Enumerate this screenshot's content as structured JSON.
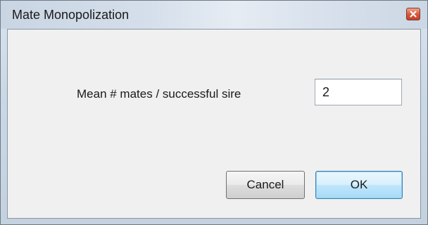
{
  "window": {
    "title": "Mate Monopolization"
  },
  "form": {
    "field_label": "Mean # mates / successful sire",
    "field_value": "2"
  },
  "buttons": {
    "cancel_label": "Cancel",
    "ok_label": "OK"
  },
  "icons": {
    "close": "close-icon"
  },
  "colors": {
    "close_button": "#d8543a",
    "default_button_border": "#3c7fb1"
  }
}
